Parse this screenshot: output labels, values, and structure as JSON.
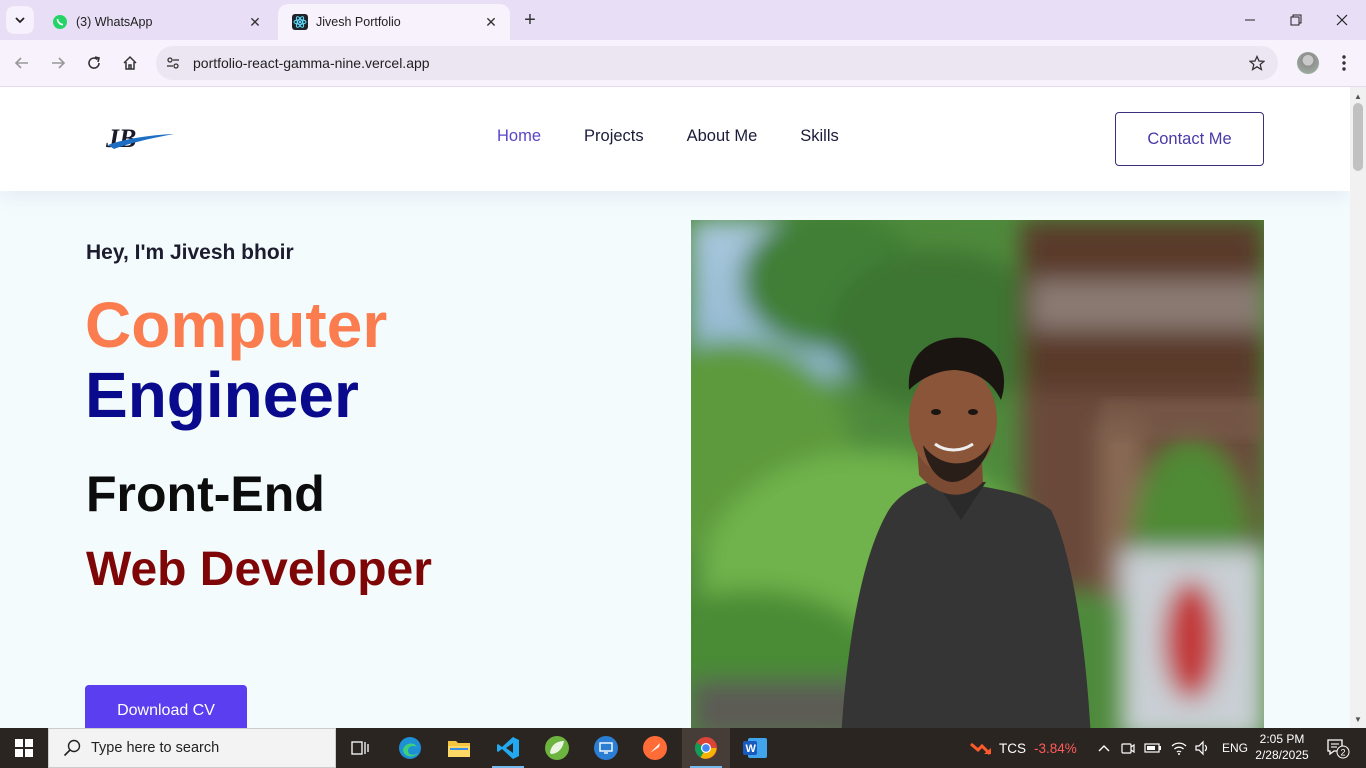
{
  "browser": {
    "tabs": [
      {
        "title": "(3) WhatsApp",
        "active": false,
        "icon": "whatsapp-icon"
      },
      {
        "title": "Jivesh Portfolio",
        "active": true,
        "icon": "react-icon"
      }
    ],
    "url": "portfolio-react-gamma-nine.vercel.app"
  },
  "site": {
    "logo_text": "JB",
    "nav": [
      {
        "label": "Home",
        "active": true
      },
      {
        "label": "Projects",
        "active": false
      },
      {
        "label": "About Me",
        "active": false
      },
      {
        "label": "Skills",
        "active": false
      }
    ],
    "contact_label": "Contact Me",
    "hero": {
      "greeting": "Hey, I'm Jivesh bhoir",
      "role_line1": "Computer",
      "role_line2": "Engineer",
      "subtitle_line1": "Front-End",
      "subtitle_line2": "Web Developer",
      "cta_label": "Download CV"
    }
  },
  "taskbar": {
    "search_placeholder": "Type here to search",
    "stock": {
      "name": "TCS",
      "change": "-3.84%"
    },
    "language": "ENG",
    "time": "2:05 PM",
    "date": "2/28/2025",
    "notifications": "2"
  },
  "colors": {
    "accent_orange": "#fb7d4f",
    "accent_navy": "#0a0a8c",
    "accent_maroon": "#7f0606",
    "cta_purple": "#5b3ef0",
    "nav_active": "#5a45c8"
  }
}
